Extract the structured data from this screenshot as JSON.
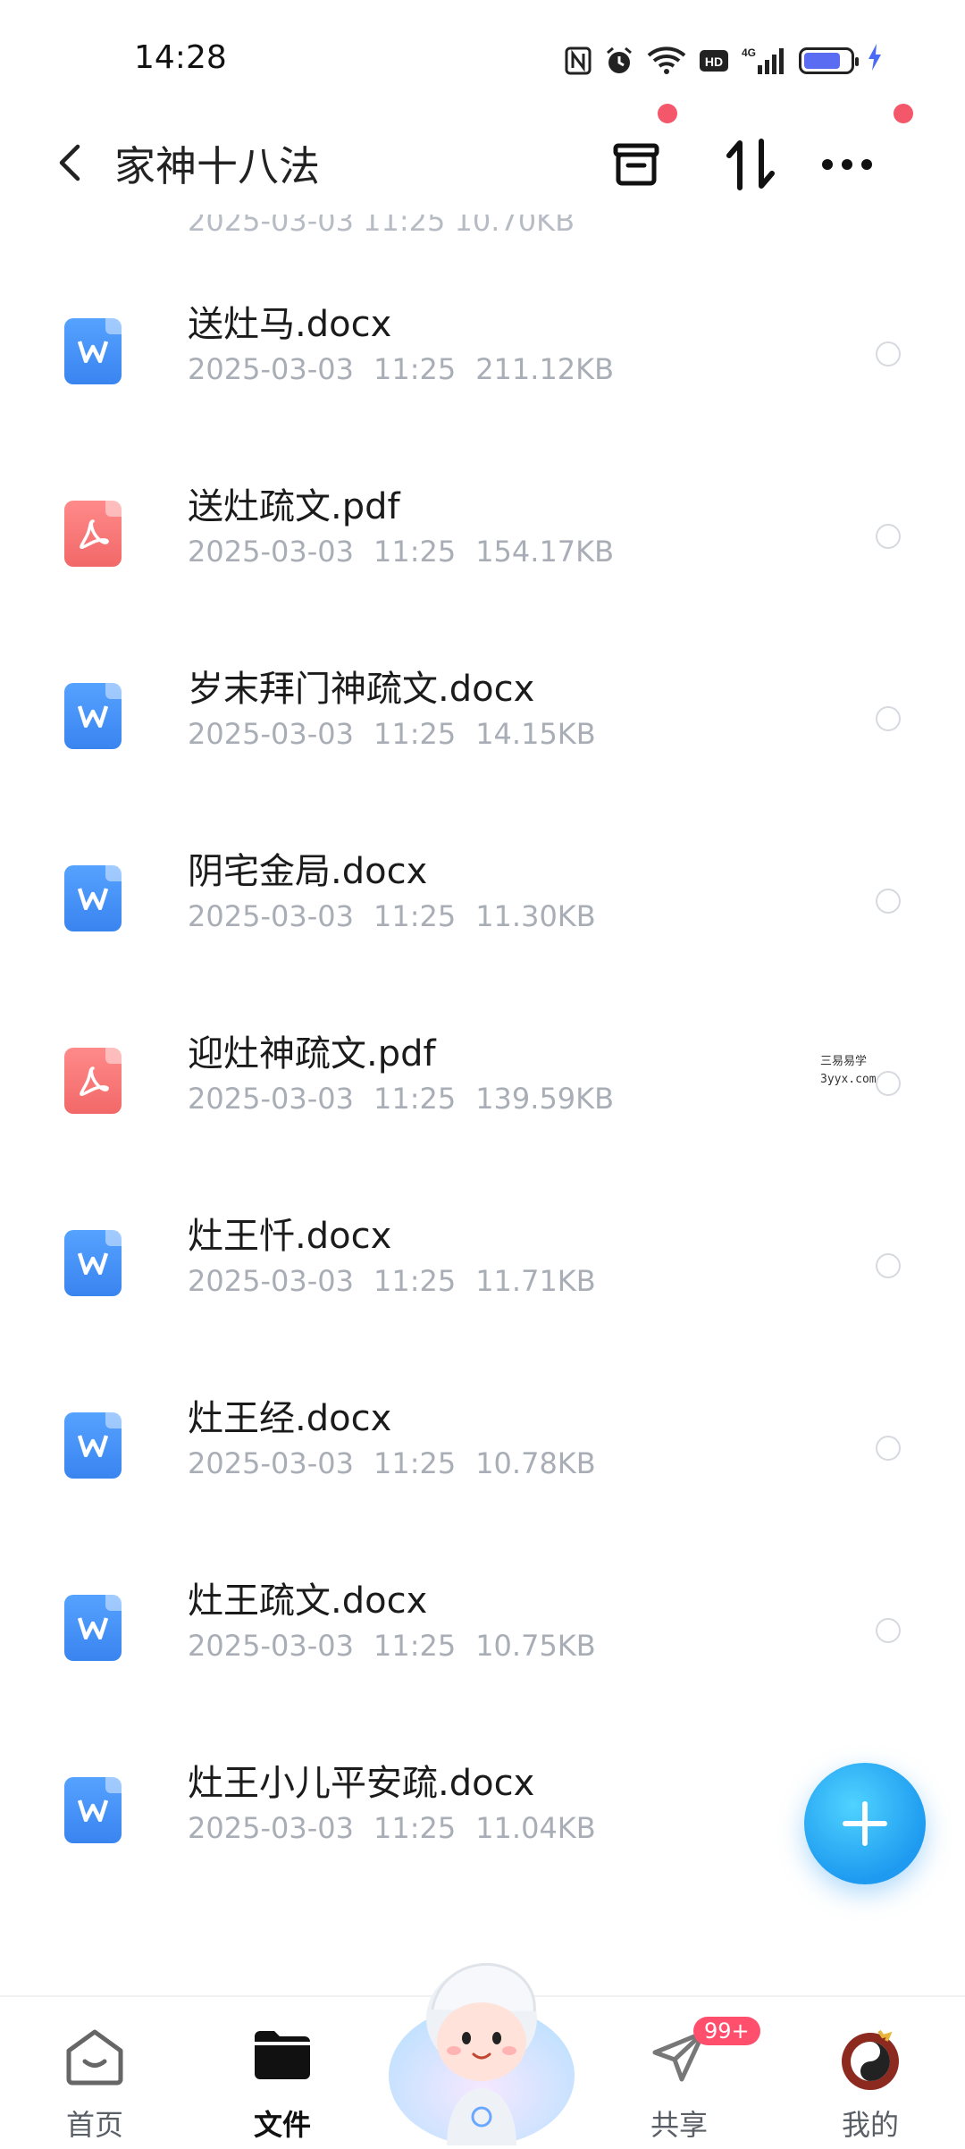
{
  "status_bar": {
    "time": "14:28",
    "battery_level": 0.8
  },
  "header": {
    "title": "家神十八法",
    "icons": [
      "back-arrow-icon",
      "archive-icon",
      "sort-icon",
      "more-icon"
    ]
  },
  "partial_item_meta": "2025-03-03  11:25  10.70KB",
  "files": [
    {
      "name": "送灶马.docx",
      "date": "2025-03-03",
      "time": "11:25",
      "size": "211.12KB",
      "type": "docx"
    },
    {
      "name": "送灶疏文.pdf",
      "date": "2025-03-03",
      "time": "11:25",
      "size": "154.17KB",
      "type": "pdf"
    },
    {
      "name": "岁末拜门神疏文.docx",
      "date": "2025-03-03",
      "time": "11:25",
      "size": "14.15KB",
      "type": "docx"
    },
    {
      "name": "阴宅金局.docx",
      "date": "2025-03-03",
      "time": "11:25",
      "size": "11.30KB",
      "type": "docx"
    },
    {
      "name": "迎灶神疏文.pdf",
      "date": "2025-03-03",
      "time": "11:25",
      "size": "139.59KB",
      "type": "pdf"
    },
    {
      "name": "灶王忏.docx",
      "date": "2025-03-03",
      "time": "11:25",
      "size": "11.71KB",
      "type": "docx"
    },
    {
      "name": "灶王经.docx",
      "date": "2025-03-03",
      "time": "11:25",
      "size": "10.78KB",
      "type": "docx"
    },
    {
      "name": "灶王疏文.docx",
      "date": "2025-03-03",
      "time": "11:25",
      "size": "10.75KB",
      "type": "docx"
    },
    {
      "name": "灶王小儿平安疏.docx",
      "date": "2025-03-03",
      "time": "11:25",
      "size": "11.04KB",
      "type": "docx"
    }
  ],
  "watermark": {
    "line1": "三易易学",
    "line2": "3yyx.com"
  },
  "fab": {
    "icon": "plus-icon"
  },
  "bottom_nav": {
    "home": "首页",
    "files": "文件",
    "share": "共享",
    "share_badge": "99+",
    "mine": "我的"
  },
  "colors": {
    "docx": "#3a84f0",
    "pdf": "#f26868",
    "accent": "#1e9bf0",
    "badge": "#ff4f6d"
  }
}
